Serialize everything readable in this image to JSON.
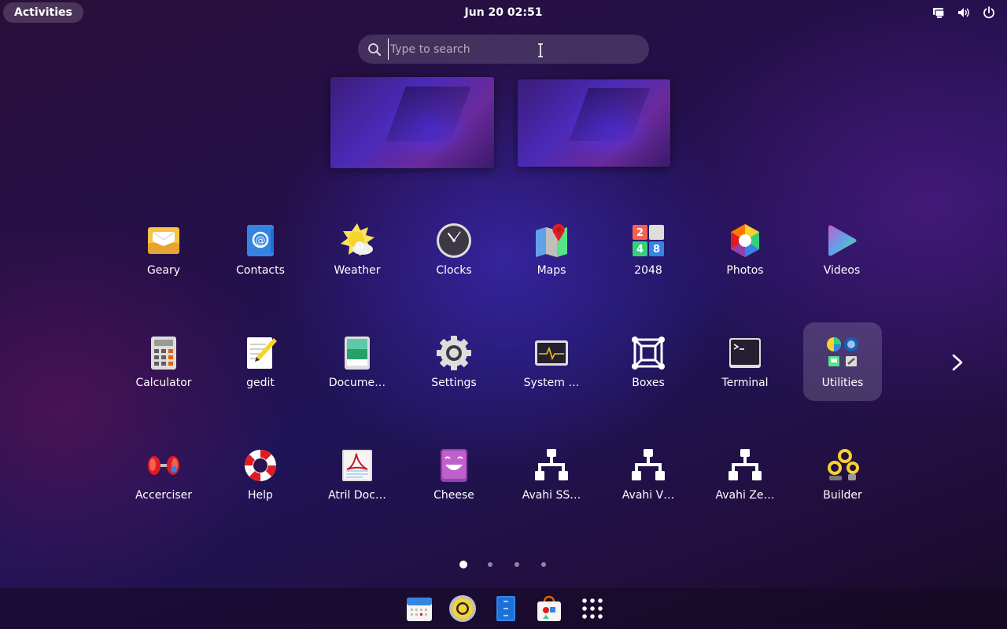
{
  "topbar": {
    "activities_label": "Activities",
    "datetime": "Jun 20  02:51",
    "tray_icons": [
      "screen-share-icon",
      "volume-icon",
      "power-icon"
    ]
  },
  "search": {
    "placeholder": "Type to search"
  },
  "workspaces": [
    "workspace-1",
    "workspace-2"
  ],
  "apps": [
    {
      "label": "Geary",
      "icon": "geary-icon"
    },
    {
      "label": "Contacts",
      "icon": "contacts-icon"
    },
    {
      "label": "Weather",
      "icon": "weather-icon"
    },
    {
      "label": "Clocks",
      "icon": "clocks-icon"
    },
    {
      "label": "Maps",
      "icon": "maps-icon"
    },
    {
      "label": "2048",
      "icon": "2048-icon"
    },
    {
      "label": "Photos",
      "icon": "photos-icon"
    },
    {
      "label": "Videos",
      "icon": "videos-icon"
    },
    {
      "label": "Calculator",
      "icon": "calculator-icon"
    },
    {
      "label": "gedit",
      "icon": "gedit-icon"
    },
    {
      "label": "Docume…",
      "icon": "document-viewer-icon"
    },
    {
      "label": "Settings",
      "icon": "settings-icon"
    },
    {
      "label": "System …",
      "icon": "system-monitor-icon"
    },
    {
      "label": "Boxes",
      "icon": "boxes-icon"
    },
    {
      "label": "Terminal",
      "icon": "terminal-icon"
    },
    {
      "label": "Utilities",
      "icon": "utilities-folder-icon",
      "selected": true
    },
    {
      "label": "Accerciser",
      "icon": "accerciser-icon"
    },
    {
      "label": "Help",
      "icon": "help-icon"
    },
    {
      "label": "Atril Doc…",
      "icon": "atril-icon"
    },
    {
      "label": "Cheese",
      "icon": "cheese-icon"
    },
    {
      "label": "Avahi SS…",
      "icon": "avahi-ssh-icon"
    },
    {
      "label": "Avahi V…",
      "icon": "avahi-vnc-icon"
    },
    {
      "label": "Avahi Ze…",
      "icon": "avahi-zeroconf-icon"
    },
    {
      "label": "Builder",
      "icon": "builder-icon"
    }
  ],
  "pagination": {
    "pages": 4,
    "current": 1
  },
  "dash": [
    "calendar-icon",
    "rhythmbox-icon",
    "files-icon",
    "software-icon",
    "show-apps-icon"
  ],
  "colors": {
    "selected_bg": "#ffffff29",
    "accent": "#3584e4"
  }
}
